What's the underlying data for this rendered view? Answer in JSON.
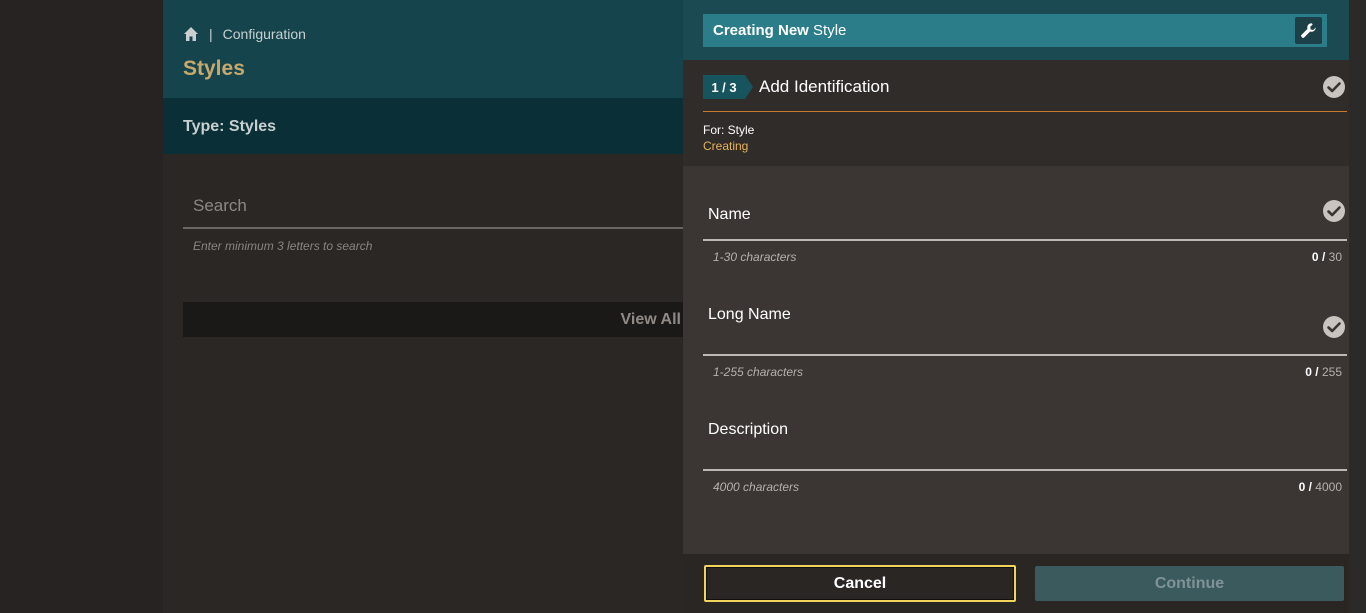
{
  "breadcrumb": {
    "section": "Configuration",
    "separator": "|"
  },
  "page": {
    "title": "Styles",
    "type_label": "Type: Styles"
  },
  "search": {
    "placeholder": "Search",
    "hint": "Enter minimum 3 letters to search"
  },
  "view_all": {
    "label": "View All"
  },
  "drawer": {
    "title_bold": "Creating New",
    "title_rest": "Style",
    "step": {
      "badge": "1 / 3",
      "title": "Add Identification"
    },
    "for_label": "For: Style",
    "status": "Creating",
    "fields": [
      {
        "label": "Name",
        "hint": "1-30 characters",
        "count": "0",
        "max": "30"
      },
      {
        "label": "Long Name",
        "hint": "1-255 characters",
        "count": "0",
        "max": "255"
      },
      {
        "label": "Description",
        "hint": "4000 characters",
        "count": "0",
        "max": "4000"
      }
    ],
    "count_separator": "/",
    "buttons": {
      "cancel": "Cancel",
      "continue": "Continue"
    }
  },
  "colors": {
    "header_teal": "#16444d",
    "title_gold": "#c8a96c",
    "accent_orange": "#c97a2a",
    "focus_yellow": "#f2d45a",
    "drawer_bar": "#2b7d8a"
  },
  "icons": [
    "home-icon",
    "wrench-icon",
    "check-circle-icon"
  ]
}
